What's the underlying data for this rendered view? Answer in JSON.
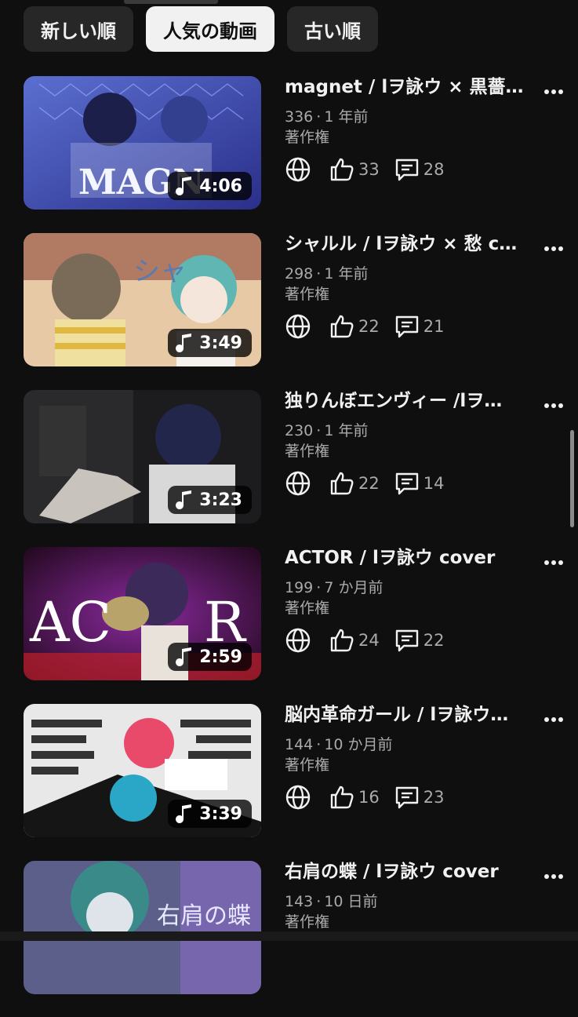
{
  "chips": [
    {
      "label": "新しい順"
    },
    {
      "label": "人気の動画"
    },
    {
      "label": "古い順"
    }
  ],
  "videos": [
    {
      "title": "magnet / lヲ詠ウ × 黒薔薇…",
      "views": "336",
      "age": "1 年前",
      "rights": "著作権",
      "likes": "33",
      "comments": "28",
      "duration": "4:06"
    },
    {
      "title": "シャルル / lヲ詠ウ × 愁 c…",
      "views": "298",
      "age": "1 年前",
      "rights": "著作権",
      "likes": "22",
      "comments": "21",
      "duration": "3:49"
    },
    {
      "title": "独りんぼエンヴィー /lヲ…",
      "views": "230",
      "age": "1 年前",
      "rights": "著作権",
      "likes": "22",
      "comments": "14",
      "duration": "3:23"
    },
    {
      "title": "ACTOR / lヲ詠ウ cover",
      "views": "199",
      "age": "7 か月前",
      "rights": "著作権",
      "likes": "24",
      "comments": "22",
      "duration": "2:59"
    },
    {
      "title": "脳内革命ガール / lヲ詠ウ…",
      "views": "144",
      "age": "10 か月前",
      "rights": "著作権",
      "likes": "16",
      "comments": "23",
      "duration": "3:39"
    },
    {
      "title": "右肩の蝶 / lヲ詠ウ cover",
      "views": "143",
      "age": "10 日前",
      "rights": "著作権",
      "likes": "",
      "comments": "",
      "duration": ""
    }
  ],
  "separator": "·",
  "icons": {
    "visibility": "globe-icon",
    "like": "thumbs-up-icon",
    "comment": "comment-icon",
    "more": "more-vertical-icon",
    "music": "music-note-icon"
  },
  "colors": {
    "background": "#0f0f0f",
    "chip": "#272727",
    "chip_active": "#f1f1f1",
    "text_secondary": "#aaaaaa"
  }
}
